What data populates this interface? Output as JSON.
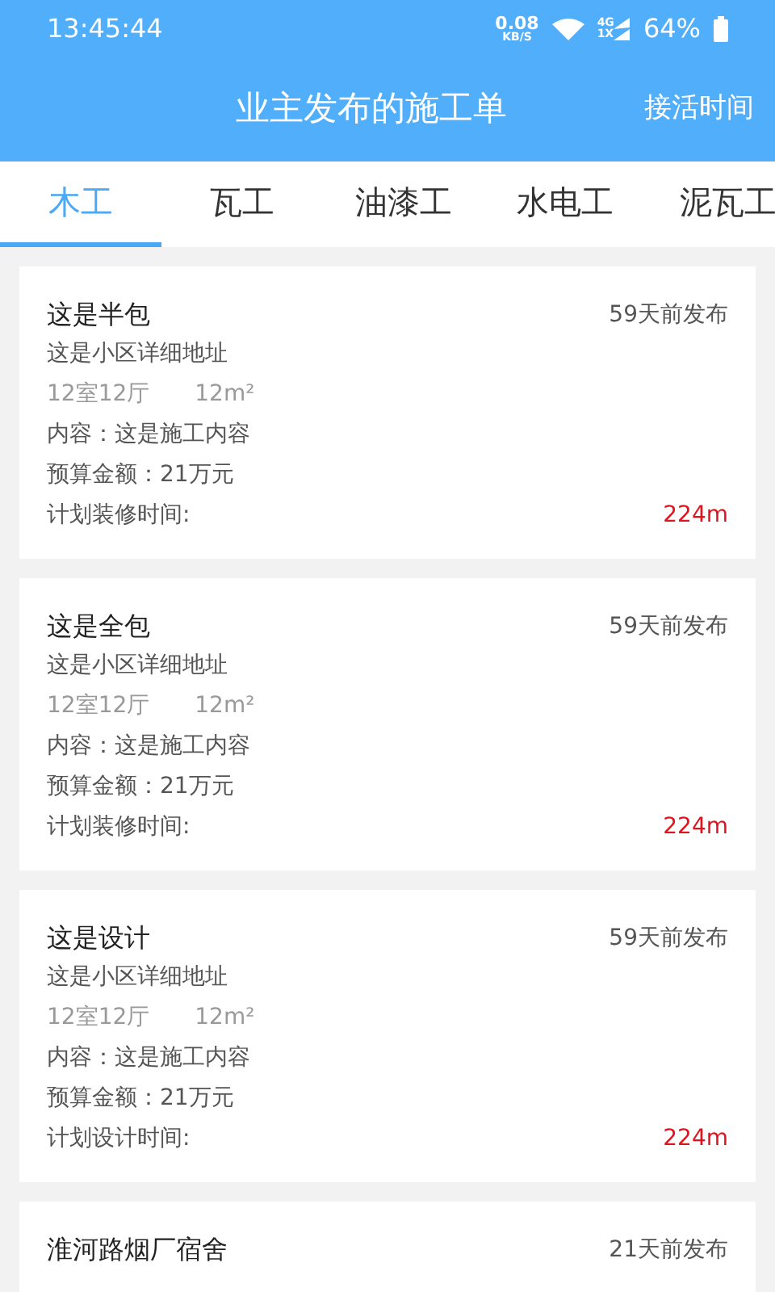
{
  "status_bar": {
    "time": "13:45:44",
    "net_speed": "0.08",
    "net_unit": "KB/S",
    "network_top": "4G",
    "network_bottom": "1X",
    "battery": "64%"
  },
  "header": {
    "title": "业主发布的施工单",
    "action": "接活时间"
  },
  "tabs": [
    {
      "label": "木工",
      "selected": true
    },
    {
      "label": "瓦工",
      "selected": false
    },
    {
      "label": "油漆工",
      "selected": false
    },
    {
      "label": "水电工",
      "selected": false
    },
    {
      "label": "泥瓦工",
      "selected": false
    }
  ],
  "orders": [
    {
      "title": "这是半包",
      "posted": "59天前发布",
      "address": "这是小区详细地址",
      "rooms": "12室12厅",
      "area": "12m²",
      "content": "内容：这是施工内容",
      "budget": "预算金额：21万元",
      "plan_label": "计划装修时间:",
      "distance": "224m"
    },
    {
      "title": "这是全包",
      "posted": "59天前发布",
      "address": "这是小区详细地址",
      "rooms": "12室12厅",
      "area": "12m²",
      "content": "内容：这是施工内容",
      "budget": "预算金额：21万元",
      "plan_label": "计划装修时间:",
      "distance": "224m"
    },
    {
      "title": "这是设计",
      "posted": "59天前发布",
      "address": "这是小区详细地址",
      "rooms": "12室12厅",
      "area": "12m²",
      "content": "内容：这是施工内容",
      "budget": "预算金额：21万元",
      "plan_label": "计划设计时间:",
      "distance": "224m"
    },
    {
      "title": "淮河路烟厂宿舍",
      "posted": "21天前发布"
    }
  ]
}
